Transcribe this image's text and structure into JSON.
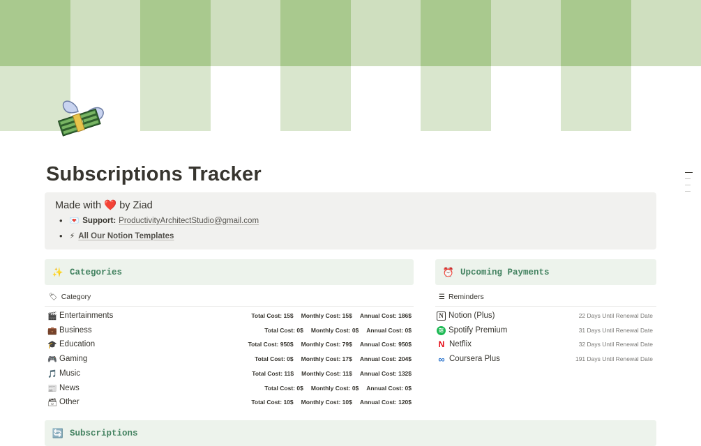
{
  "page": {
    "title": "Subscriptions Tracker",
    "icon": "money-with-wings-icon"
  },
  "callout": {
    "made_with": "Made with ❤️ by Ziad",
    "support_icon": "💌",
    "support_label": "Support:",
    "support_email": "ProductivityArchitectStudio@gmail.com",
    "templates_icon": "⚡",
    "templates_link": "All Our Notion Templates"
  },
  "categories": {
    "icon": "✨",
    "title": "Categories",
    "property_label": "Category",
    "property_icon": "🏷",
    "items": [
      {
        "icon": "🎬",
        "name": "Entertainments",
        "total": "Total Cost: 15$",
        "monthly": "Monthly Cost: 15$",
        "annual": "Annual Cost: 186$"
      },
      {
        "icon": "💼",
        "name": "Business",
        "total": "Total Cost: 0$",
        "monthly": "Monthly Cost: 0$",
        "annual": "Annual Cost: 0$"
      },
      {
        "icon": "🎓",
        "name": "Education",
        "total": "Total Cost: 950$",
        "monthly": "Monthly Cost: 79$",
        "annual": "Annual Cost: 950$"
      },
      {
        "icon": "🎮",
        "name": "Gaming",
        "total": "Total Cost: 0$",
        "monthly": "Monthly Cost: 17$",
        "annual": "Annual Cost: 204$"
      },
      {
        "icon": "🎵",
        "name": "Music",
        "total": "Total Cost: 11$",
        "monthly": "Monthly Cost: 11$",
        "annual": "Annual Cost: 132$"
      },
      {
        "icon": "📰",
        "name": "News",
        "total": "Total Cost: 0$",
        "monthly": "Monthly Cost: 0$",
        "annual": "Annual Cost: 0$"
      },
      {
        "icon": "🗃",
        "name": "Other",
        "total": "Total Cost: 10$",
        "monthly": "Monthly Cost: 10$",
        "annual": "Annual Cost: 120$"
      }
    ]
  },
  "upcoming": {
    "icon": "⏰",
    "title": "Upcoming Payments",
    "list_label": "Reminders",
    "list_icon": "☰",
    "items": [
      {
        "icon": "N",
        "name": "Notion (Plus)",
        "days": "22 Days Until Renewal Date"
      },
      {
        "icon": "≋",
        "name": "Spotify Premium",
        "days": "31 Days Until Renewal Date"
      },
      {
        "icon": "N",
        "name": "Netflix",
        "days": "32 Days Until Renewal Date"
      },
      {
        "icon": "∞",
        "name": "Coursera Plus",
        "days": "191 Days Until Renewal Date"
      }
    ]
  },
  "subscriptions": {
    "icon": "🔄",
    "title": "Subscriptions"
  },
  "colors": {
    "section_bg": "#edf3ec",
    "section_title": "#448361",
    "callout_bg": "#f1f1ef",
    "cover_green": "#a9c98e"
  }
}
